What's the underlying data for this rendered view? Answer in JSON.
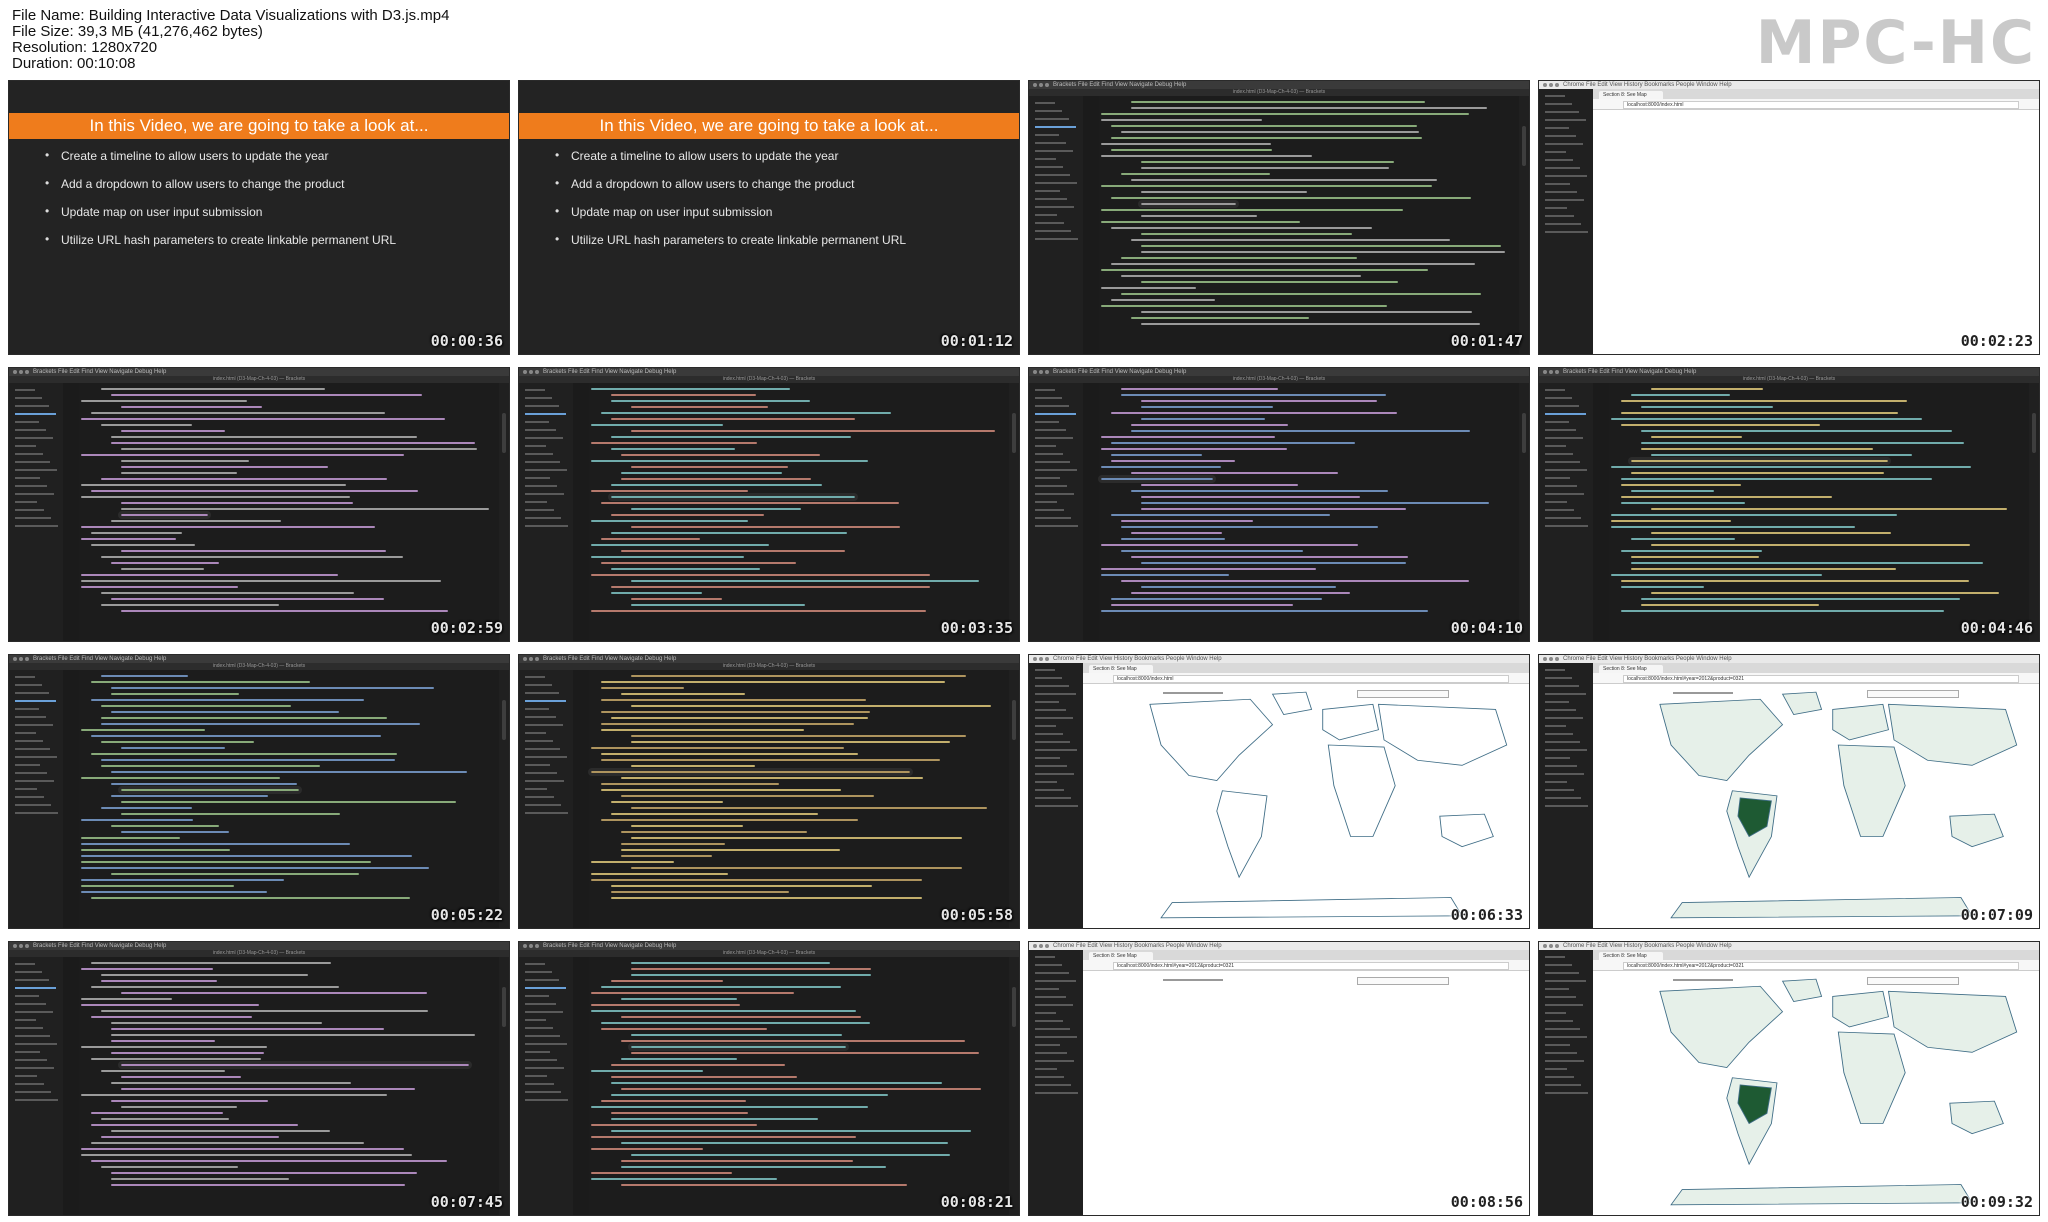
{
  "info": {
    "file_name_label": "File Name:",
    "file_name": "Building Interactive Data Visualizations with D3.js.mp4",
    "file_size_label": "File Size:",
    "file_size": "39,3 МБ (41,276,462 bytes)",
    "resolution_label": "Resolution:",
    "resolution": "1280x720",
    "duration_label": "Duration:",
    "duration": "00:10:08"
  },
  "logo": "MPC-HC",
  "colors": {
    "slide_header": "#ef7c1c",
    "editor_bg": "#1c1c1c",
    "map_land": "#e6f0e9",
    "map_border": "#3f6d86",
    "map_highlight": "#1e5a33"
  },
  "slide": {
    "title": "In this Video, we are going to take a look at...",
    "bullets": [
      "Create a timeline to allow users to update the year",
      "Add a dropdown to allow users to change the product",
      "Update map on user input submission",
      "Utilize URL hash parameters to create linkable permanent URL"
    ]
  },
  "app": {
    "editor_menu": "Brackets   File   Edit   Find   View   Navigate   Debug   Help",
    "editor_title": "index.html (D3-Map-Ch-4-03) — Brackets",
    "browser_menu": "Chrome   File   Edit   View   History   Bookmarks   People   Window   Help",
    "browser_tab": "Section 8: See Map",
    "browser_url": "localhost:8000/index.html",
    "browser_url_hash": "localhost:8000/index.html#year=2012&product=0321"
  },
  "thumbnails": [
    {
      "time": "00:00:36",
      "kind": "slide"
    },
    {
      "time": "00:01:12",
      "kind": "slide"
    },
    {
      "time": "00:01:47",
      "kind": "editor"
    },
    {
      "time": "00:02:23",
      "kind": "browser-blank"
    },
    {
      "time": "00:02:59",
      "kind": "editor"
    },
    {
      "time": "00:03:35",
      "kind": "editor"
    },
    {
      "time": "00:04:10",
      "kind": "editor"
    },
    {
      "time": "00:04:46",
      "kind": "editor"
    },
    {
      "time": "00:05:22",
      "kind": "editor"
    },
    {
      "time": "00:05:58",
      "kind": "editor"
    },
    {
      "time": "00:06:33",
      "kind": "browser-map"
    },
    {
      "time": "00:07:09",
      "kind": "browser-map-filled"
    },
    {
      "time": "00:07:45",
      "kind": "editor"
    },
    {
      "time": "00:08:21",
      "kind": "editor"
    },
    {
      "time": "00:08:56",
      "kind": "browser-blank"
    },
    {
      "time": "00:09:32",
      "kind": "browser-map-filled"
    }
  ]
}
